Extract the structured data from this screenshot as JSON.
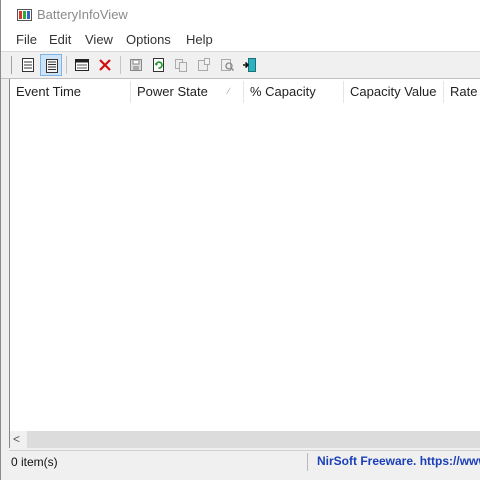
{
  "window": {
    "title": "BatteryInfoView"
  },
  "menu": [
    "File",
    "Edit",
    "View",
    "Options",
    "Help"
  ],
  "toolbar": {
    "buttons": [
      {
        "icon": "properties-icon"
      },
      {
        "icon": "battery-log-icon",
        "active": true
      },
      {
        "icon": "html-report-icon"
      },
      {
        "icon": "delete-icon"
      },
      {
        "icon": "save-icon"
      },
      {
        "icon": "refresh-icon"
      },
      {
        "icon": "copy-icon"
      },
      {
        "icon": "clipboard-icon"
      },
      {
        "icon": "find-icon"
      },
      {
        "icon": "exit-icon"
      }
    ]
  },
  "table": {
    "columns": [
      "Event Time",
      "Power State",
      "% Capacity",
      "Capacity Value",
      "Rate"
    ],
    "sort_column": "Power State",
    "rows": []
  },
  "status": {
    "count": "0 item(s)",
    "link": "NirSoft Freeware. https://www"
  },
  "colors": {
    "link": "#1a3fb8",
    "active_button": "#cde3f7"
  }
}
